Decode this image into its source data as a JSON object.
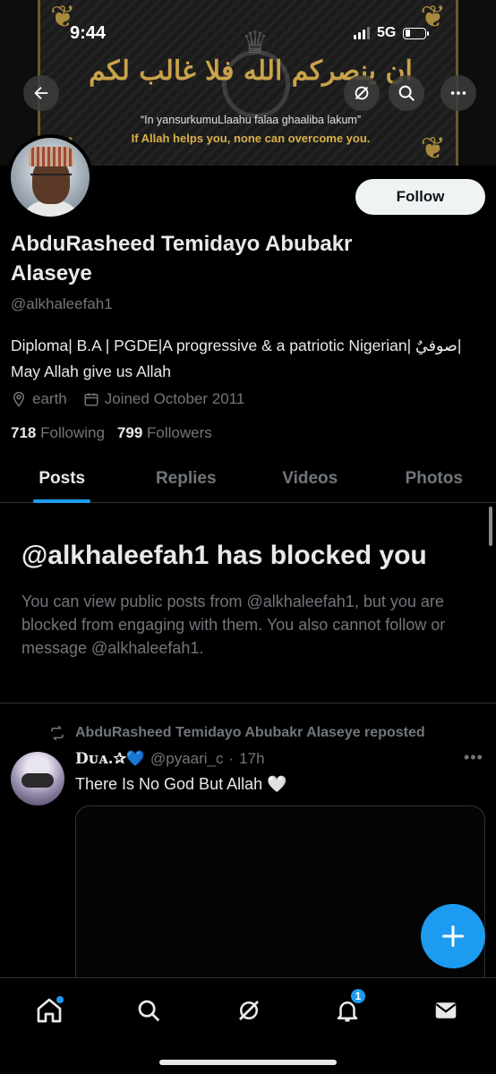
{
  "status_bar": {
    "time": "9:44",
    "network": "5G"
  },
  "banner": {
    "arabic_text": "ان ينصركم الله فلا غالب لكم",
    "transliteration": "“In yansurkumuLlaahu falaa ghaaliba lakum”",
    "english": "If Allah helps you, none can overcome you."
  },
  "profile": {
    "follow_label": "Follow",
    "name": "AbduRasheed Temidayo Abubakr Alaseye",
    "handle": "@alkhaleefah1",
    "bio": "Diploma| B.A | PGDE|A progressive & a patriotic Nigerian| صوفيٌ| May Allah give us Allah",
    "location": "earth",
    "joined": "Joined October 2011",
    "following_count": "718",
    "following_label": "Following",
    "followers_count": "799",
    "followers_label": "Followers"
  },
  "tabs": [
    {
      "label": "Posts",
      "active": true
    },
    {
      "label": "Replies",
      "active": false
    },
    {
      "label": "Videos",
      "active": false
    },
    {
      "label": "Photos",
      "active": false
    }
  ],
  "blocked": {
    "title": "@alkhaleefah1 has blocked you",
    "description": "You can view public posts from @alkhaleefah1, but you are blocked from engaging with them. You also cannot follow or message @alkhaleefah1."
  },
  "post": {
    "repost_label": "AbduRasheed Temidayo Abubakr Alaseye reposted",
    "author_name": "Dᴜᴀ.✰💙",
    "author_handle": "@pyaari_c",
    "separator": "·",
    "time": "17h",
    "text": "There Is No God But Allah 🤍"
  },
  "nav": {
    "notification_count": "1"
  },
  "icons": {
    "back": "arrow-left-icon",
    "grok": "grok-icon",
    "search": "search-icon",
    "more": "more-icon",
    "location": "location-icon",
    "calendar": "calendar-icon",
    "repost": "repost-icon",
    "compose": "plus-icon",
    "home": "home-icon",
    "notifications": "bell-icon",
    "messages": "envelope-icon"
  },
  "colors": {
    "accent": "#1d9bf0",
    "background": "#000000",
    "muted": "#71767b",
    "text": "#e7e9ea",
    "banner_gold": "#c9a24a"
  }
}
